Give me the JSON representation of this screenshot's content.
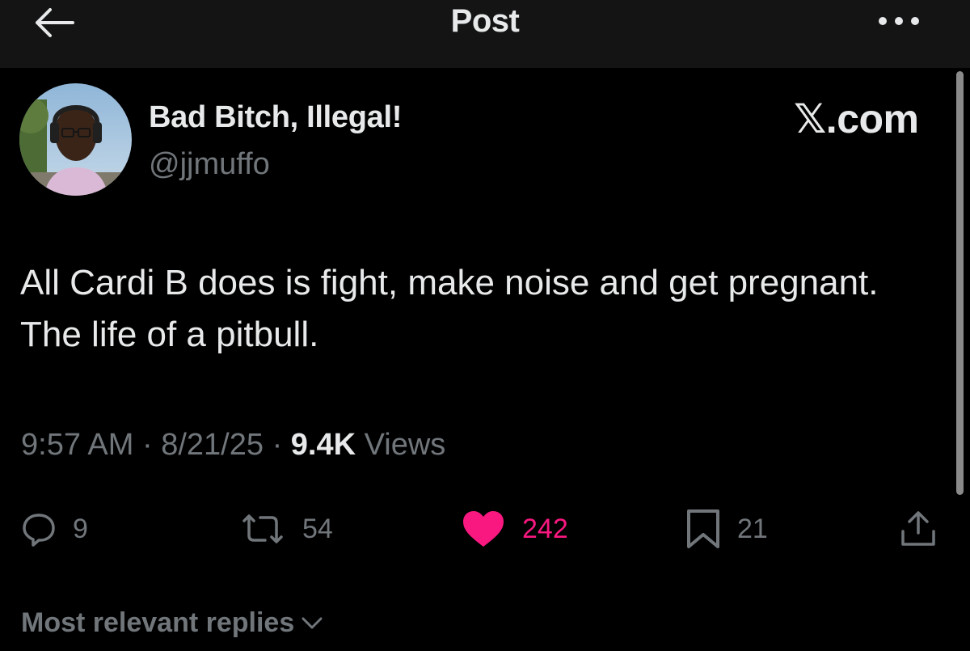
{
  "header": {
    "title": "Post",
    "back_icon": "arrow-left-icon",
    "more_icon": "more-dots-icon"
  },
  "post": {
    "author": {
      "display_name": "Bad Bitch, Illegal!",
      "handle": "@jjmuffo"
    },
    "watermark": {
      "x_char": "𝕏",
      "domain": ".com"
    },
    "text": "All Cardi B does is fight, make noise and get pregnant. The life of a pitbull.",
    "time": "9:57 AM",
    "date": "8/21/25",
    "separator": "·",
    "views_count": "9.4K",
    "views_label": "Views"
  },
  "actions": {
    "replies": {
      "icon": "reply-icon",
      "count": "9"
    },
    "reposts": {
      "icon": "repost-icon",
      "count": "54"
    },
    "likes": {
      "icon": "heart-icon",
      "count": "242",
      "liked": true
    },
    "bookmarks": {
      "icon": "bookmark-icon",
      "count": "21"
    },
    "share": {
      "icon": "share-icon"
    }
  },
  "replies_sort": {
    "label": "Most relevant replies",
    "icon": "chevron-down-icon"
  },
  "colors": {
    "background": "#000000",
    "header_background": "#141414",
    "text_primary": "#e7e9ea",
    "text_secondary": "#71767b",
    "like_pink": "#f91880"
  }
}
